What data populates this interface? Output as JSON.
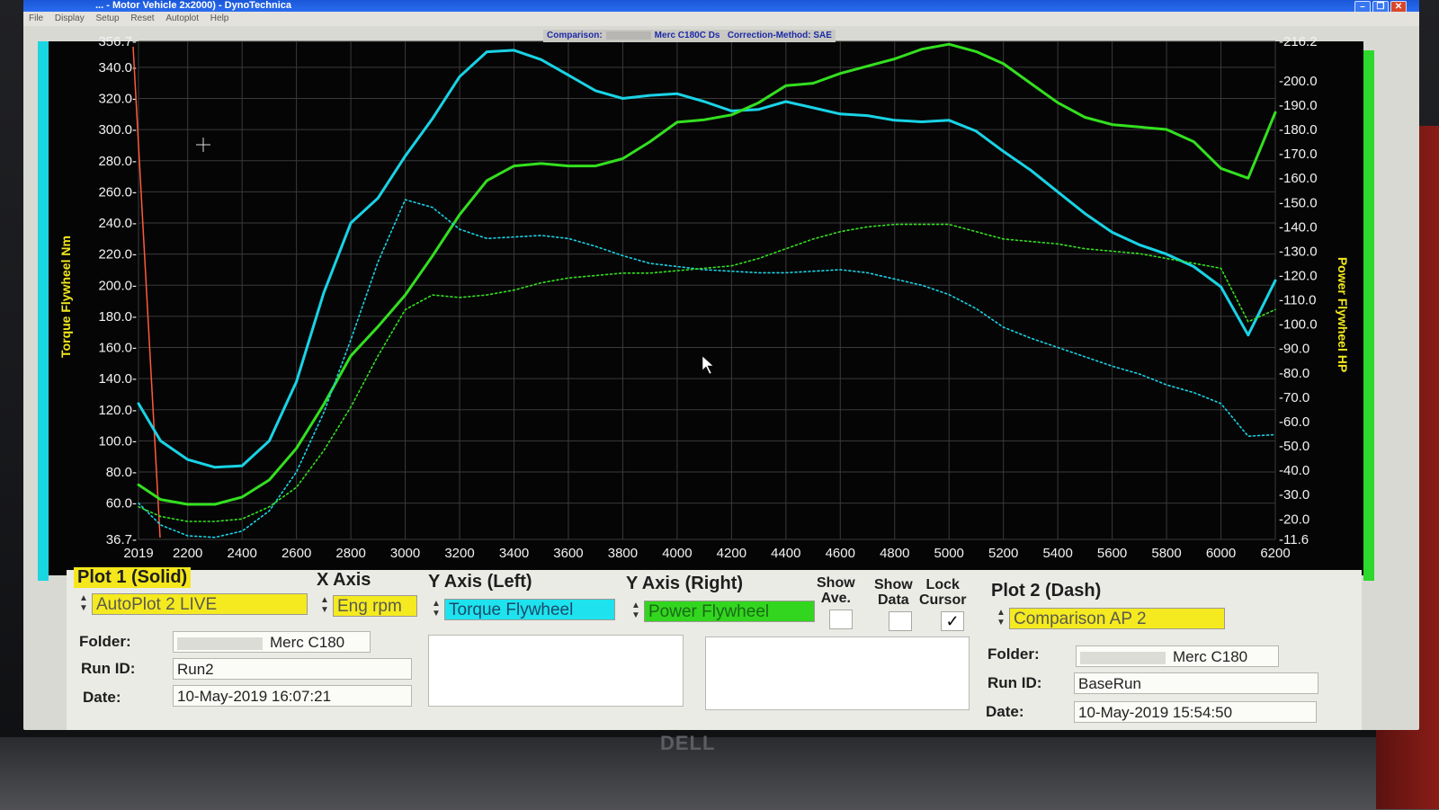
{
  "window": {
    "title": "... - Motor Vehicle 2x2000) - DynoTechnica"
  },
  "menu": [
    "File",
    "Display",
    "Setup",
    "Reset",
    "Autoplot",
    "Help"
  ],
  "banner": {
    "comparison_label": "Comparison:",
    "vehicle": "Merc C180C Ds",
    "correction_label": "Correction-Method: SAE"
  },
  "chart_data": {
    "type": "line",
    "xlabel": "",
    "ylabel_left": "Torque Flywheel Nm",
    "ylabel_right": "Power Flywheel HP",
    "x_ticks": [
      "2019",
      "2200",
      "2400",
      "2600",
      "2800",
      "3000",
      "3200",
      "3400",
      "3600",
      "3800",
      "4000",
      "4200",
      "4400",
      "4600",
      "4800",
      "5000",
      "5200",
      "5400",
      "5600",
      "5800",
      "6000",
      "6200"
    ],
    "y_left_ticks": [
      "356.7-",
      "340.0-",
      "320.0-",
      "300.0-",
      "280.0-",
      "260.0-",
      "240.0-",
      "220.0-",
      "200.0-",
      "180.0-",
      "160.0-",
      "140.0-",
      "120.0-",
      "100.0-",
      "80.0-",
      "60.0-",
      "36.7-"
    ],
    "y_right_ticks": [
      "-216.2",
      "-200.0",
      "-190.0",
      "-180.0",
      "-170.0",
      "-160.0",
      "-150.0",
      "-140.0",
      "-130.0",
      "-120.0",
      "-110.0",
      "-100.0",
      "-90.0",
      "-80.0",
      "-70.0",
      "-60.0",
      "-50.0",
      "-40.0",
      "-30.0",
      "-20.0",
      "-11.6"
    ],
    "xlim": [
      2019,
      6200
    ],
    "ylim_left": [
      36.7,
      356.7
    ],
    "ylim_right": [
      11.6,
      216.2
    ],
    "grid": true,
    "colors": {
      "torque": "#19d3e6",
      "power": "#33e01f",
      "cursor": "#ff5a3c",
      "background": "#050505",
      "grid": "#3a3a3a"
    },
    "series": [
      {
        "axis": "left",
        "style": "solid",
        "color": "#19d3e6",
        "x": [
          2019,
          2100,
          2200,
          2300,
          2400,
          2500,
          2600,
          2700,
          2800,
          2900,
          3000,
          3100,
          3200,
          3300,
          3400,
          3500,
          3600,
          3700,
          3800,
          3900,
          4000,
          4100,
          4200,
          4300,
          4400,
          4500,
          4600,
          4700,
          4800,
          4900,
          5000,
          5100,
          5200,
          5300,
          5400,
          5500,
          5600,
          5700,
          5800,
          5900,
          6000,
          6100,
          6200
        ],
        "y": [
          124,
          100,
          88,
          83,
          84,
          100,
          138,
          195,
          240,
          256,
          283,
          307,
          334,
          350,
          351,
          345,
          335,
          325,
          320,
          322,
          323,
          318,
          312,
          313,
          318,
          314,
          310,
          309,
          306,
          305,
          306,
          299,
          286,
          274,
          260,
          246,
          234,
          226,
          220,
          212,
          199,
          168,
          203
        ]
      },
      {
        "axis": "right",
        "style": "solid",
        "color": "#33e01f",
        "x": [
          2019,
          2100,
          2200,
          2300,
          2400,
          2500,
          2600,
          2700,
          2800,
          2900,
          3000,
          3100,
          3200,
          3300,
          3400,
          3500,
          3600,
          3700,
          3800,
          3900,
          4000,
          4100,
          4200,
          4300,
          4400,
          4500,
          4600,
          4700,
          4800,
          4900,
          5000,
          5100,
          5200,
          5300,
          5400,
          5500,
          5600,
          5700,
          5800,
          5900,
          6000,
          6100,
          6200
        ],
        "y": [
          34,
          28,
          26,
          26,
          29,
          36,
          49,
          67,
          87,
          99,
          112,
          128,
          145,
          159,
          165,
          166,
          165,
          165,
          168,
          175,
          183,
          184,
          186,
          191,
          198,
          199,
          203,
          206,
          209,
          213,
          215,
          212,
          207,
          199,
          191,
          185,
          182,
          181,
          180,
          175,
          164,
          160,
          187
        ]
      },
      {
        "axis": "left",
        "style": "dash",
        "color": "#19d3e6",
        "x": [
          2019,
          2100,
          2200,
          2300,
          2400,
          2500,
          2600,
          2700,
          2800,
          2900,
          3000,
          3100,
          3200,
          3300,
          3400,
          3500,
          3600,
          3700,
          3800,
          3900,
          4000,
          4100,
          4200,
          4300,
          4400,
          4500,
          4600,
          4700,
          4800,
          4900,
          5000,
          5100,
          5200,
          5300,
          5400,
          5500,
          5600,
          5700,
          5800,
          5900,
          6000,
          6100,
          6200
        ],
        "y": [
          60,
          46,
          39,
          38,
          42,
          55,
          80,
          118,
          165,
          215,
          255,
          250,
          236,
          230,
          231,
          232,
          230,
          225,
          219,
          214,
          212,
          210,
          209,
          208,
          208,
          209,
          210,
          208,
          204,
          200,
          194,
          185,
          173,
          166,
          160,
          154,
          148,
          143,
          136,
          131,
          124,
          103,
          104
        ]
      },
      {
        "axis": "right",
        "style": "dash",
        "color": "#33e01f",
        "x": [
          2019,
          2100,
          2200,
          2300,
          2400,
          2500,
          2600,
          2700,
          2800,
          2900,
          3000,
          3100,
          3200,
          3300,
          3400,
          3500,
          3600,
          3700,
          3800,
          3900,
          4000,
          4100,
          4200,
          4300,
          4400,
          4500,
          4600,
          4700,
          4800,
          4900,
          5000,
          5100,
          5200,
          5300,
          5400,
          5500,
          5600,
          5700,
          5800,
          5900,
          6000,
          6100,
          6200
        ],
        "y": [
          25,
          21,
          19,
          19,
          20,
          25,
          33,
          48,
          66,
          87,
          106,
          112,
          111,
          112,
          114,
          117,
          119,
          120,
          121,
          121,
          122,
          123,
          124,
          127,
          131,
          135,
          138,
          140,
          141,
          141,
          141,
          138,
          135,
          134,
          133,
          131,
          130,
          129,
          127,
          125,
          123,
          101,
          106
        ]
      }
    ]
  },
  "plot1": {
    "header": "Plot 1 (Solid)",
    "autoplot": "AutoPlot 2 LIVE",
    "folder_label": "Folder:",
    "folder": "Merc C180",
    "runid_label": "Run ID:",
    "runid": "Run2",
    "date_label": "Date:",
    "date": "10-May-2019  16:07:21"
  },
  "xaxis": {
    "header": "X Axis",
    "value": "Eng rpm"
  },
  "yleft": {
    "header": "Y Axis (Left)",
    "value": "Torque Flywheel"
  },
  "yright": {
    "header": "Y Axis (Right)",
    "value": "Power Flywheel"
  },
  "toggles": {
    "show_ave_1": "Show",
    "show_ave_2": "Ave.",
    "show_data_1": "Show",
    "show_data_2": "Data",
    "lock_cursor_1": "Lock",
    "lock_cursor_2": "Cursor",
    "check_mark": "✓"
  },
  "plot2": {
    "header": "Plot 2 (Dash)",
    "autoplot": "Comparison AP 2",
    "folder_label": "Folder:",
    "folder": "Merc C180",
    "runid_label": "Run ID:",
    "runid": "BaseRun",
    "date_label": "Date:",
    "date": "10-May-2019  15:54:50"
  },
  "monitor": {
    "brand": "DELL"
  }
}
